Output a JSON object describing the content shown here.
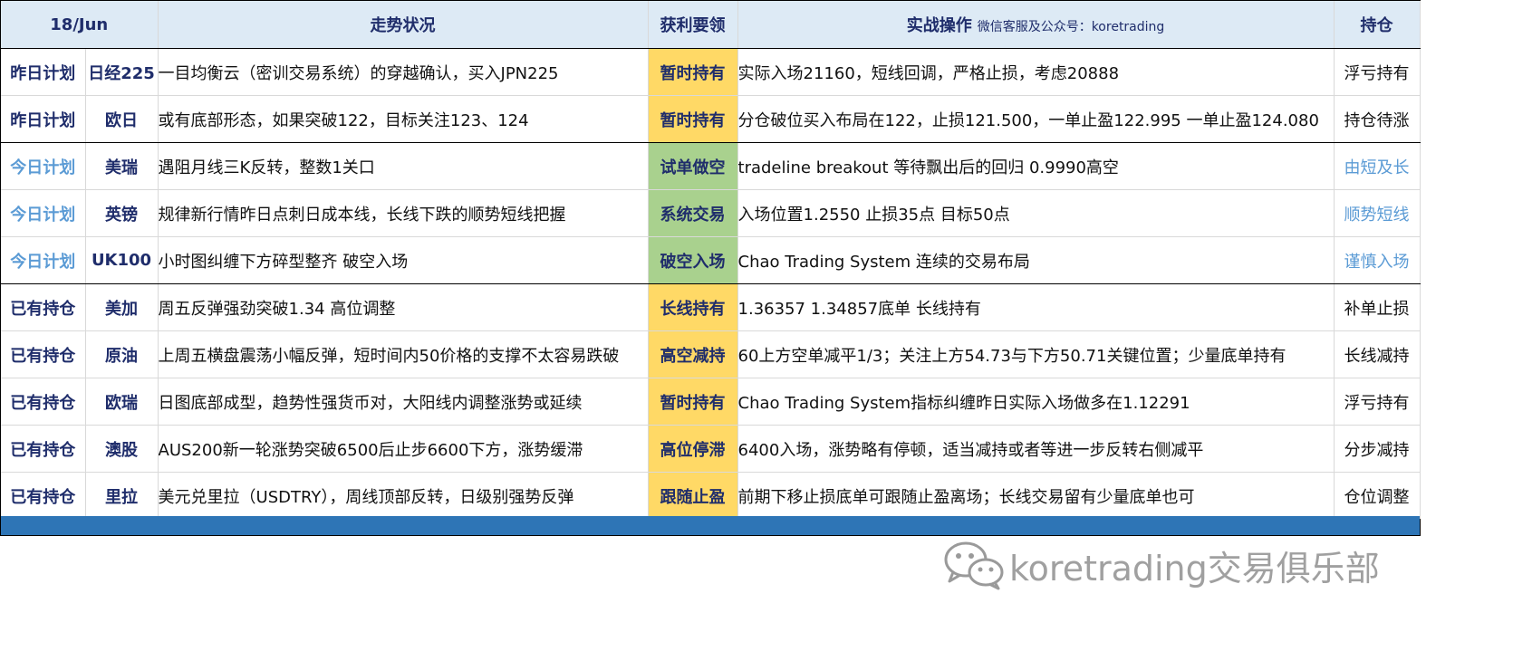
{
  "header": {
    "date": "18/Jun",
    "trend": "走势状况",
    "key": "获利要领",
    "action": "实战操作",
    "action_note": "微信客服及公众号：koretrading",
    "hold": "持仓"
  },
  "rows": [
    {
      "type": "昨日计划",
      "asset": "日经225",
      "desc": "一目均衡云（密训交易系统）的穿越确认，买入JPN225",
      "key": "暂时持有",
      "action": "实际入场21160，短线回调，严格止损，考虑20888",
      "hold": "浮亏持有"
    },
    {
      "type": "昨日计划",
      "asset": "欧日",
      "desc": "或有底部形态，如果突破122，目标关注123、124",
      "key": "暂时持有",
      "action": "分仓破位买入布局在122，止损121.500，一单止盈122.995 一单止盈124.080",
      "hold": "持仓待涨"
    },
    {
      "type": "今日计划",
      "asset": "美瑞",
      "desc": "遇阻月线三K反转，整数1关口",
      "key": "试单做空",
      "action": "tradeline breakout 等待飘出后的回归 0.9990高空",
      "hold": "由短及长"
    },
    {
      "type": "今日计划",
      "asset": "英镑",
      "desc": "规律新行情昨日点刺日成本线，长线下跌的顺势短线把握",
      "key": "系统交易",
      "action": " 入场位置1.2550 止损35点 目标50点",
      "hold": "顺势短线"
    },
    {
      "type": "今日计划",
      "asset": "UK100",
      "desc": "小时图纠缠下方碎型整齐 破空入场",
      "key": "破空入场",
      "action": "Chao Trading System 连续的交易布局",
      "hold": "谨慎入场"
    },
    {
      "type": "已有持仓",
      "asset": "美加",
      "desc": "周五反弹强劲突破1.34 高位调整",
      "key": "长线持有",
      "action": "1.36357 1.34857底单 长线持有",
      "hold": "补单止损"
    },
    {
      "type": "已有持仓",
      "asset": "原油",
      "desc": "上周五横盘震荡小幅反弹，短时间内50价格的支撑不太容易跌破",
      "key": "高空减持",
      "action": "60上方空单减平1/3；关注上方54.73与下方50.71关键位置；少量底单持有",
      "hold": "长线减持"
    },
    {
      "type": "已有持仓",
      "asset": "欧瑞",
      "desc": "日图底部成型，趋势性强货币对，大阳线内调整涨势或延续",
      "key": "暂时持有",
      "action": "Chao Trading System指标纠缠昨日实际入场做多在1.12291",
      "hold": "浮亏持有"
    },
    {
      "type": "已有持仓",
      "asset": "澳股",
      "desc": "AUS200新一轮涨势突破6500后止步6600下方，涨势缓滞",
      "key": "高位停滞",
      "action": "6400入场，涨势略有停顿，适当减持或者等进一步反转右侧减平",
      "hold": "分步减持"
    },
    {
      "type": "已有持仓",
      "asset": "里拉",
      "desc": "美元兑里拉（USDTRY），周线顶部反转，日级别强势反弹",
      "key": "跟随止盈",
      "action": "前期下移止损底单可跟随止盈离场；长线交易留有少量底单也可",
      "hold": "仓位调整"
    }
  ],
  "colors": {
    "header_bg": "#ddeaf5",
    "key_yellow": "#ffd966",
    "key_green": "#a9d18e",
    "today_text": "#5b9bd5",
    "navy_text": "#1f2d6b",
    "footer_bar": "#2e75b6"
  },
  "watermark": {
    "icon": "wechat-icon",
    "text": "koretrading交易俱乐部"
  }
}
